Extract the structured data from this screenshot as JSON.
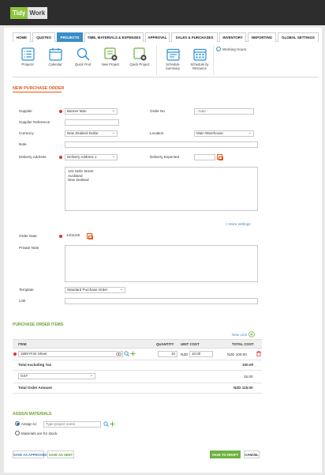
{
  "app": {
    "logo_left": "Tidy",
    "logo_right": "Work",
    "brand_green": "#8cc63f",
    "accent_blue": "#3a8ec8",
    "accent_orange": "#e05a1f"
  },
  "nav": {
    "tabs": [
      {
        "label": "HOME",
        "active": false
      },
      {
        "label": "QUOTES",
        "active": false
      },
      {
        "label": "PROJECTS",
        "active": true
      },
      {
        "label": "TIME, MATERIALS & EXPENSES",
        "active": false
      },
      {
        "label": "APPROVAL",
        "active": false
      },
      {
        "label": "SALES & PURCHASES",
        "active": false
      },
      {
        "label": "INVENTORY",
        "active": false
      },
      {
        "label": "REPORTING",
        "active": false
      },
      {
        "label": "GLOBAL SETTINGS",
        "active": false
      }
    ]
  },
  "toolbar": {
    "items": [
      {
        "label": "Projects",
        "icon": "projects-list-icon"
      },
      {
        "label": "Calendar",
        "icon": "calendar-icon"
      },
      {
        "label": "Quick Find",
        "icon": "search-icon"
      },
      {
        "label": "New Project",
        "icon": "new-project-icon"
      },
      {
        "label": "Quick Project",
        "icon": "quick-project-icon"
      },
      {
        "label": "Schedule Summary",
        "icon": "schedule-summary-icon"
      },
      {
        "label": "Schedule by Resource",
        "icon": "schedule-resource-icon"
      }
    ],
    "working_hours": "Working Hours"
  },
  "form": {
    "title": "NEW PURCHASE ORDER",
    "supplier_label": "Supplier",
    "supplier_value": "Banner Man",
    "supplier_ref_label": "Supplier Reference",
    "supplier_ref_value": "",
    "currency_label": "Currency",
    "currency_value": "New Zealand Dollar",
    "note_label": "Note",
    "note_value": "",
    "order_no_label": "Order No",
    "order_no_value": "- Auto -",
    "location_label": "Location",
    "location_value": "Main Warehouse",
    "delivery_address_label": "Delivery Address",
    "delivery_address_value": "Delivery Address 1",
    "delivery_expected_label": "Delivery Expected",
    "delivery_expected_value": "",
    "address_lines": [
      "123 Hello Street",
      "Auckland",
      "New Zealand"
    ],
    "more_settings": "> More settings",
    "order_date_label": "Order Date",
    "order_date_value": "14/11/25",
    "private_note_label": "Private Note",
    "template_label": "Template",
    "template_value": "Standard Purchase Order",
    "link_label": "Link"
  },
  "items": {
    "section_title": "PURCHASE ORDER ITEMS",
    "new_line": "New Line",
    "columns": {
      "item": "ITEM",
      "quantity": "QUANTITY",
      "unit_cost": "UNIT COST",
      "total_cost": "TOTAL COST"
    },
    "rows": [
      {
        "item": "1MM Print Sheet",
        "quantity": "10",
        "currency": "NZD",
        "unit_cost": "10.00",
        "total": "NZD 100.00"
      }
    ],
    "total_excl_label": "Total excluding Tax",
    "total_excl_value": "100.00",
    "tax_option": "GST",
    "tax_value": "15.00",
    "total_amount_label": "Total Order Amount",
    "total_amount_value": "NZD 115.00"
  },
  "assign": {
    "section_title": "ASSIGN MATERIALS",
    "assign_to_label": "Assign to:",
    "project_placeholder": "Type project name",
    "stock_label": "Materials are for stock."
  },
  "actions": {
    "save_approved": "SAVE AS APPROVED",
    "save_sent": "SAVE AS SENT",
    "save_draft": "SAVE TO DRAFT",
    "cancel": "CANCEL"
  }
}
